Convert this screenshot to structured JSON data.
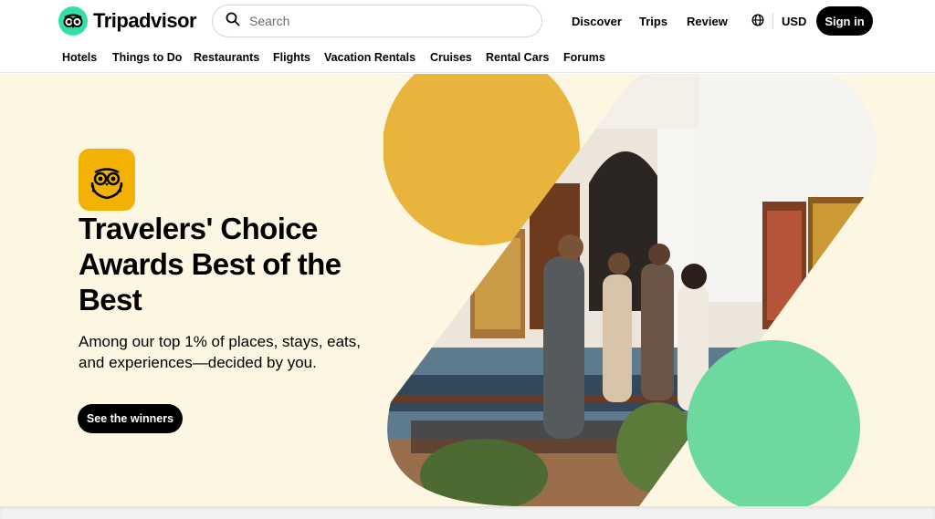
{
  "brand": {
    "name": "Tripadvisor"
  },
  "search": {
    "placeholder": "Search"
  },
  "topnav": {
    "discover": "Discover",
    "trips": "Trips",
    "review": "Review"
  },
  "currency": {
    "code": "USD"
  },
  "auth": {
    "signin_label": "Sign in"
  },
  "categories": [
    "Hotels",
    "Things to Do",
    "Restaurants",
    "Flights",
    "Vacation Rentals",
    "Cruises",
    "Rental Cars",
    "Forums"
  ],
  "hero": {
    "title": "Travelers' Choice Awards Best of the Best",
    "subtitle": "Among our top 1% of places, stays, eats, and experiences—decided by you.",
    "cta_label": "See the winners"
  },
  "icons": {
    "logo": "owl-logo-icon",
    "search": "search-icon",
    "globe": "globe-icon",
    "award": "owl-award-badge-icon"
  },
  "colors": {
    "brand_green": "#34e0a1",
    "hero_background": "#fdf6e3",
    "accent_yellow": "#e9b43c",
    "accent_green": "#6ed99e",
    "button_black": "#000000"
  }
}
